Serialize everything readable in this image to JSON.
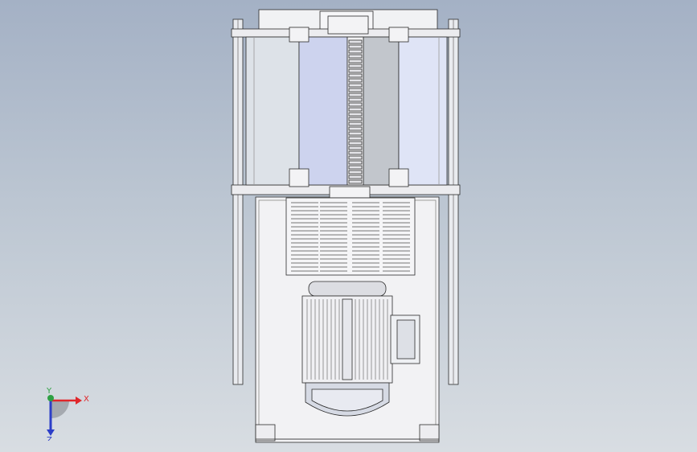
{
  "view": {
    "background_top": "#a4b1c5",
    "background_bottom": "#d8dde2",
    "model_line_color": "#2b2b2b",
    "panel_colors": {
      "light_grey": "#dde2e8",
      "lavender": "#cdd3ee",
      "grey": "#c2c6cc",
      "pale_blue": "#dfe4f6",
      "sheet_metal": "#f4f4f6"
    }
  },
  "triad": {
    "x_label": "X",
    "y_label": "Y",
    "z_label": "Z",
    "x_color": "#e0262a",
    "y_color": "#2ea043",
    "z_color": "#2c3ec8"
  },
  "icons": {
    "view_triad": "coordinate-axes-icon"
  }
}
